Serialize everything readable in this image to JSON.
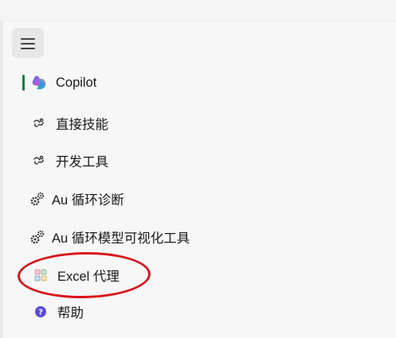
{
  "menu": {
    "icon": "hamburger-icon"
  },
  "nav": {
    "items": [
      {
        "label": "Copilot",
        "icon": "copilot-icon",
        "active": true
      },
      {
        "label": "直接技能",
        "icon": "skill-link-icon"
      },
      {
        "label": "开发工具",
        "icon": "skill-link-icon"
      },
      {
        "label": "Au 循环诊断",
        "icon": "gears-icon"
      },
      {
        "label": "Au 循环模型可视化工具",
        "icon": "gears-icon"
      },
      {
        "label": "Excel 代理",
        "icon": "excel-agent-icon",
        "highlighted": true
      },
      {
        "label": "帮助",
        "icon": "help-icon"
      }
    ]
  },
  "colors": {
    "active_indicator": "#1f7a3f",
    "annotation": "#d9151c",
    "help_icon": "#5b4bdb"
  }
}
